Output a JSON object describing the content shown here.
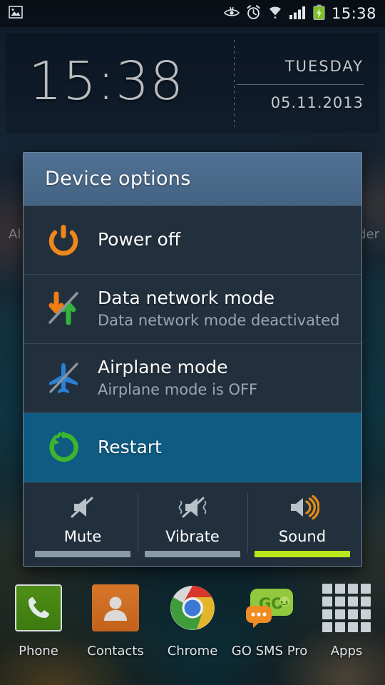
{
  "status_bar": {
    "left_icons": [
      {
        "name": "gallery-image-icon"
      }
    ],
    "right_icons": [
      {
        "name": "eye-smart-stay-icon"
      },
      {
        "name": "alarm-clock-icon"
      },
      {
        "name": "wifi-icon"
      },
      {
        "name": "cellular-signal-icon"
      },
      {
        "name": "battery-charging-icon"
      }
    ],
    "time": "15:38"
  },
  "clock_widget": {
    "time": "15:38",
    "day": "TUESDAY",
    "date": "05.11.2013"
  },
  "background_text": {
    "left": "Al",
    "right": "der"
  },
  "dialog": {
    "title": "Device options",
    "options": [
      {
        "icon": "power-off-icon",
        "title": "Power off",
        "subtitle": "",
        "selected": false
      },
      {
        "icon": "data-network-mode-icon",
        "title": "Data network mode",
        "subtitle": "Data network mode deactivated",
        "selected": false
      },
      {
        "icon": "airplane-mode-icon",
        "title": "Airplane mode",
        "subtitle": "Airplane mode is OFF",
        "selected": false
      },
      {
        "icon": "restart-icon",
        "title": "Restart",
        "subtitle": "",
        "selected": true
      }
    ],
    "sound_modes": [
      {
        "icon": "mute-icon",
        "label": "Mute",
        "active": false
      },
      {
        "icon": "vibrate-icon",
        "label": "Vibrate",
        "active": false
      },
      {
        "icon": "sound-icon",
        "label": "Sound",
        "active": true
      }
    ]
  },
  "dock": [
    {
      "icon": "phone-icon",
      "label": "Phone"
    },
    {
      "icon": "contacts-icon",
      "label": "Contacts"
    },
    {
      "icon": "chrome-icon",
      "label": "Chrome"
    },
    {
      "icon": "go-sms-pro-icon",
      "label": "GO SMS Pro"
    },
    {
      "icon": "apps-grid-icon",
      "label": "Apps"
    }
  ],
  "colors": {
    "accent_orange": "#f0871a",
    "accent_green": "#3cb52e",
    "accent_blue": "#2b7fd4",
    "selected_row": "#0f5b82",
    "dialog_header": "#4a6a8a",
    "dialog_body": "#22303d",
    "active_bar_lime": "#b9e81c"
  }
}
